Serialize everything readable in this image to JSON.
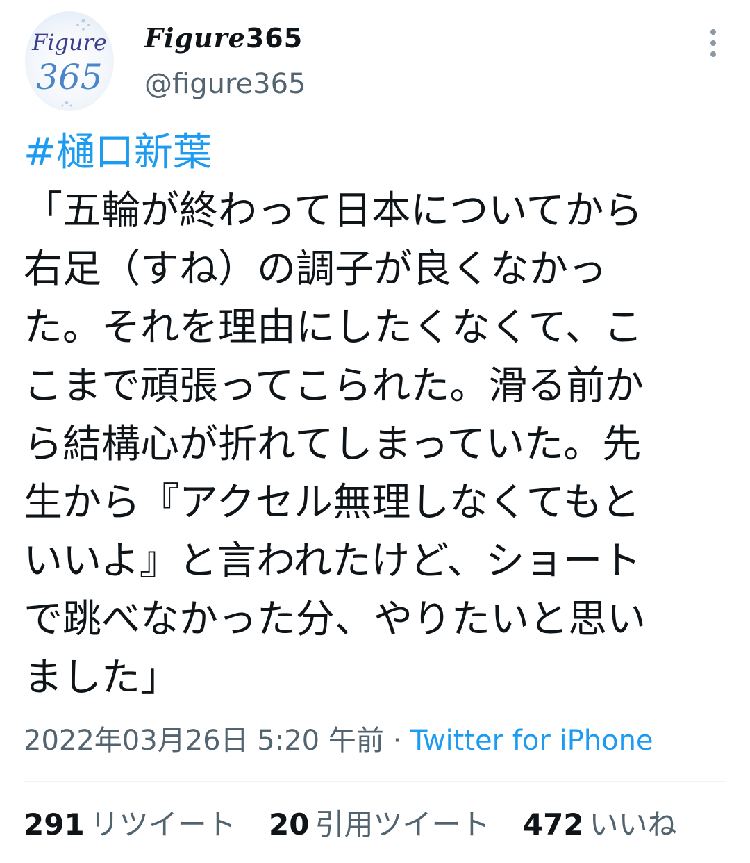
{
  "tweet": {
    "author": {
      "avatar_text_top": "Figure",
      "avatar_text_bottom": "365",
      "display_name_script": "Figure",
      "display_name_number": "365",
      "handle": "@figure365"
    },
    "more_icon": "more-vertical-icon",
    "hashtag": "#樋口新葉",
    "body_lines": [
      "「五輪が終わって日本についてから",
      "右足（すね）の調子が良くなかっ",
      "た。それを理由にしたくなくて、こ",
      "こまで頑張ってこられた。滑る前か",
      "ら結構心が折れてしまっていた。先",
      "生から『アクセル無理しなくてもと",
      "いいよ』と言われたけど、ショート",
      "で跳べなかった分、やりたいと思い",
      "ました」"
    ],
    "timestamp": "2022年03月26日 5:20 午前",
    "separator": " · ",
    "source": "Twitter for iPhone",
    "stats": {
      "retweets": "291",
      "retweets_label": "リツイート",
      "quotes": "20",
      "quotes_label": "引用ツイート",
      "likes": "472",
      "likes_label": "いいね"
    },
    "colors": {
      "link": "#1d9bf0",
      "secondary_text": "#536471",
      "primary_text": "#0f1419"
    }
  }
}
